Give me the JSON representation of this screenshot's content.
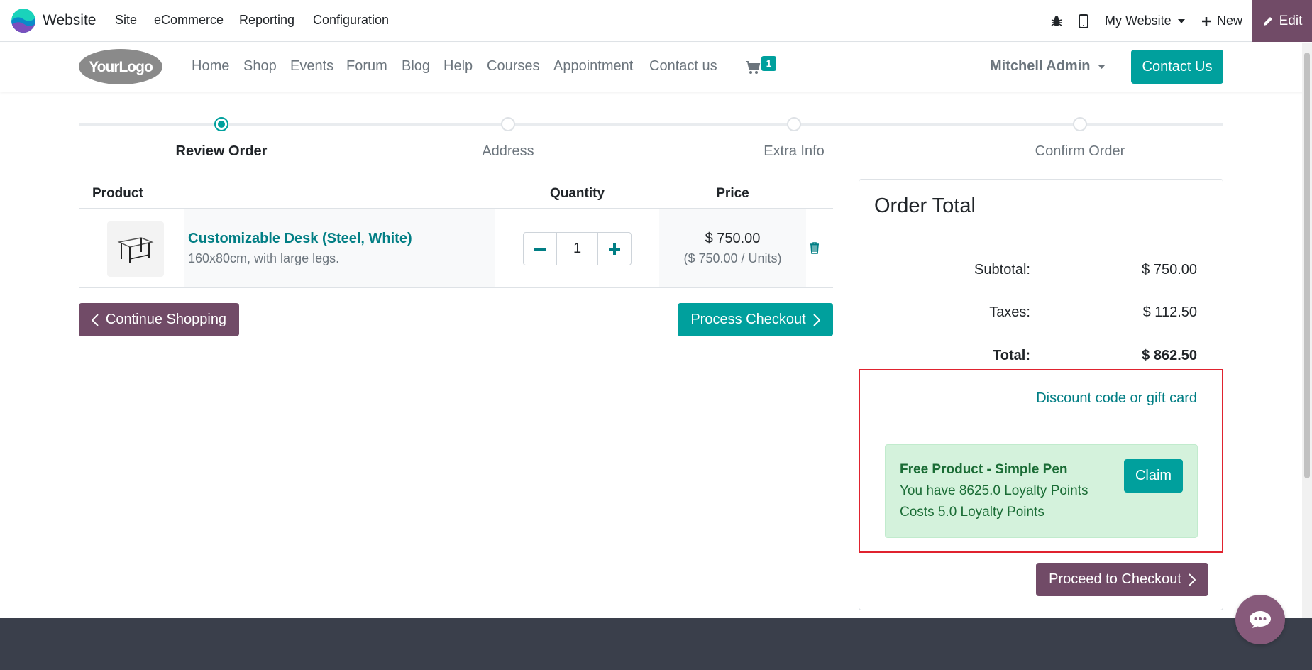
{
  "topbar": {
    "app_name": "Website",
    "menus": [
      "Site",
      "eCommerce",
      "Reporting",
      "Configuration"
    ],
    "website_selector": "My Website",
    "new_label": "New",
    "edit_label": "Edit"
  },
  "navbar": {
    "logo_text": "YourLogo",
    "links": [
      "Home",
      "Shop",
      "Events",
      "Forum",
      "Blog",
      "Help",
      "Courses",
      "Appointment",
      "Contact us"
    ],
    "cart_count": "1",
    "user": "Mitchell Admin",
    "cta": "Contact Us"
  },
  "wizard": {
    "steps": [
      "Review Order",
      "Address",
      "Extra Info",
      "Confirm Order"
    ],
    "active_step": "Review Order"
  },
  "cart": {
    "headers": {
      "product": "Product",
      "quantity": "Quantity",
      "price": "Price"
    },
    "items": [
      {
        "name": "Customizable Desk (Steel, White)",
        "description": "160x80cm, with large legs.",
        "quantity": "1",
        "price": "$ 750.00",
        "unit_price": "($ 750.00 / Units)"
      }
    ],
    "continue_label": "Continue Shopping",
    "process_label": "Process Checkout"
  },
  "order_total": {
    "title": "Order Total",
    "subtotal_label": "Subtotal:",
    "subtotal": "$ 750.00",
    "taxes_label": "Taxes:",
    "taxes": "$ 112.50",
    "total_label": "Total:",
    "total": "$ 862.50",
    "discount_link": "Discount code or gift card",
    "reward": {
      "title": "Free Product - Simple Pen",
      "points_line": "You have 8625.0 Loyalty Points",
      "cost_line": "Costs 5.0 Loyalty Points",
      "claim_label": "Claim"
    },
    "proceed_label": "Proceed to Checkout"
  },
  "colors": {
    "primary": "#00a09d",
    "secondary": "#714b67",
    "link": "#017e84",
    "highlight_border": "#e0232f",
    "footer": "#3a3f4b"
  },
  "icons": [
    "bug-icon",
    "mobile-icon",
    "caret-down-icon",
    "plus-icon",
    "pencil-icon",
    "cart-icon",
    "minus-icon",
    "trash-icon",
    "chevron-left-icon",
    "chevron-right-icon",
    "chat-icon"
  ]
}
